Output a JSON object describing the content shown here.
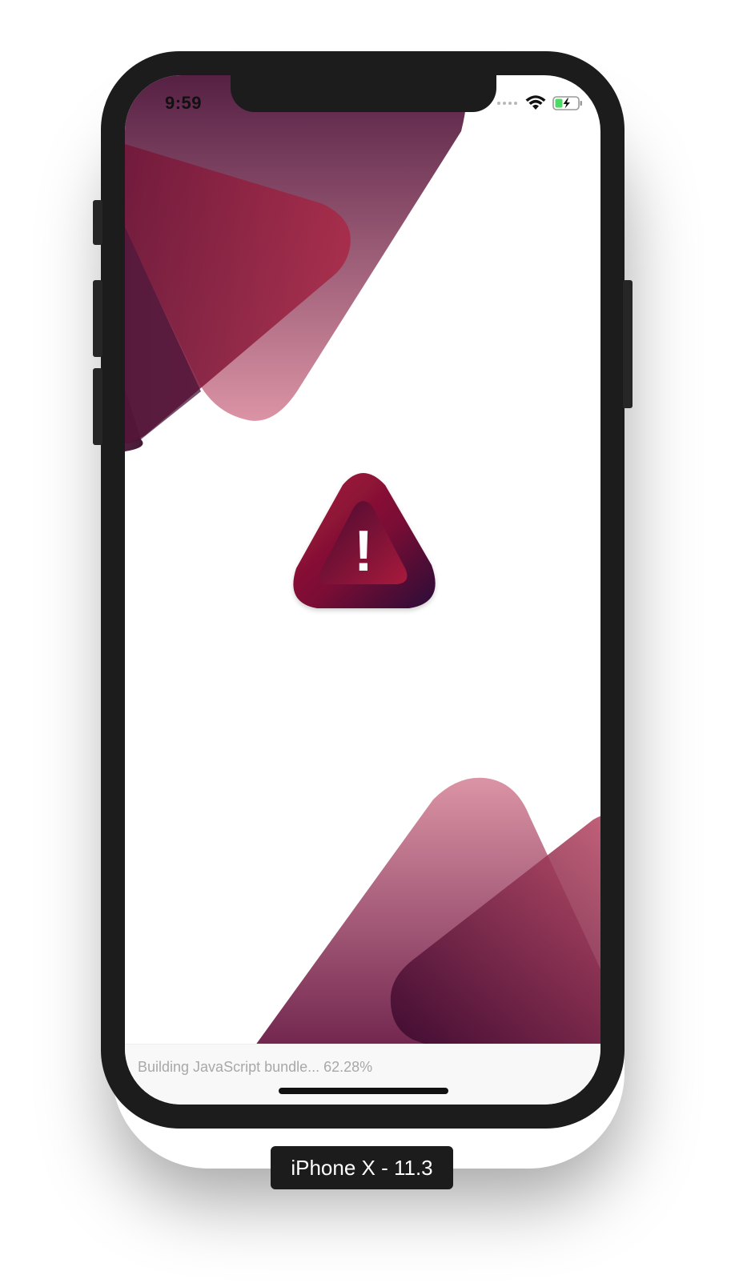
{
  "status_bar": {
    "time": "9:59",
    "icons": [
      "signal-dots-icon",
      "wifi-icon",
      "battery-charging-icon"
    ]
  },
  "main": {
    "icon": "warning-triangle-icon",
    "glyph": "!"
  },
  "bundle": {
    "text": "Building JavaScript bundle... 62.28%",
    "progress_percent": 62.28
  },
  "simulator": {
    "device_label": "iPhone X - 11.3"
  },
  "colors": {
    "accent_crimson": "#9b1b3c",
    "deep_purple": "#2a0a2e",
    "pink": "#d98ea0",
    "bezel": "#1c1c1c"
  }
}
